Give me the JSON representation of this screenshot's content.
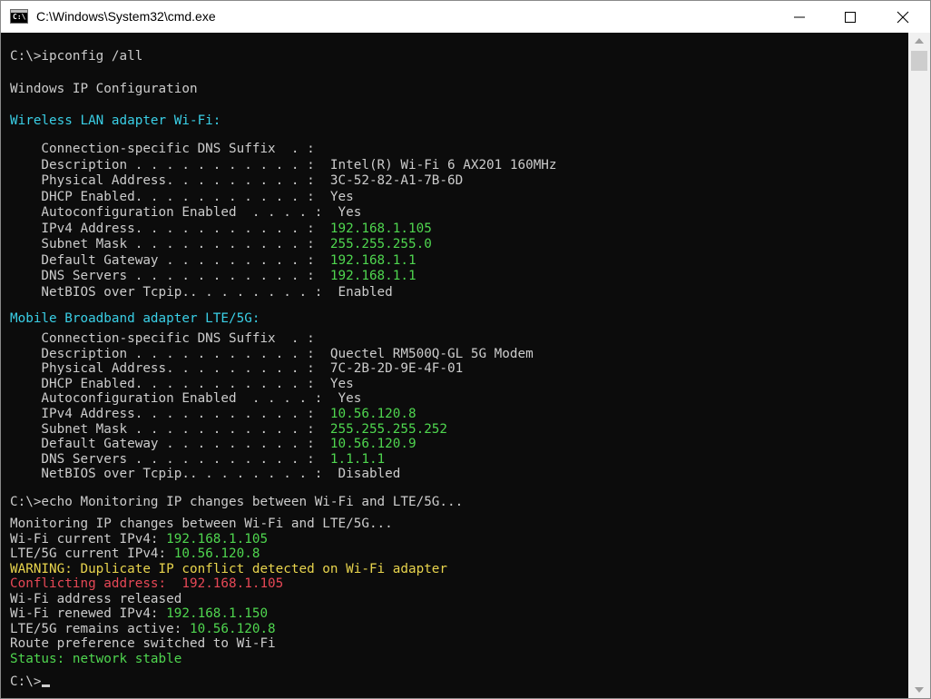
{
  "window": {
    "title": "C:\\Windows\\System32\\cmd.exe",
    "icon_name": "cmd-app-icon",
    "icon_text": "C:\\",
    "controls": {
      "minimize": "minimize-icon",
      "maximize": "maximize-icon",
      "close": "close-icon"
    }
  },
  "colors": {
    "background": "#0c0c0c",
    "text": "#cccccc",
    "header": "#3acfe6",
    "value": "#4fd64f",
    "warning": "#e8d44d",
    "error": "#e74856"
  },
  "console": {
    "command1": "C:\\>ipconfig /all",
    "heading": "Windows IP Configuration",
    "wifi": {
      "header": "Wireless LAN adapter Wi-Fi:",
      "rows": [
        {
          "label": "    Connection-specific DNS Suffix  . :",
          "value": ""
        },
        {
          "label": "    Description . . . . . . . . . . . :  ",
          "value": "Intel(R) Wi-Fi 6 AX201 160MHz"
        },
        {
          "label": "    Physical Address. . . . . . . . . :  ",
          "value": "3C-52-82-A1-7B-6D"
        },
        {
          "label": "    DHCP Enabled. . . . . . . . . . . :  ",
          "value": "Yes"
        },
        {
          "label": "    Autoconfiguration Enabled  . . . . :  ",
          "value": "Yes"
        },
        {
          "label": "    IPv4 Address. . . . . . . . . . . :  ",
          "value": "192.168.1.105"
        },
        {
          "label": "    Subnet Mask . . . . . . . . . . . :  ",
          "value": "255.255.255.0"
        },
        {
          "label": "    Default Gateway . . . . . . . . . :  ",
          "value": "192.168.1.1"
        },
        {
          "label": "    DNS Servers . . . . . . . . . . . :  ",
          "value": "192.168.1.1"
        },
        {
          "label": "    NetBIOS over Tcpip.. . . . . . . . :  ",
          "value": "Enabled"
        }
      ]
    },
    "lte": {
      "header": "Mobile Broadband adapter LTE/5G:",
      "rows": [
        {
          "label": "    Connection-specific DNS Suffix  . :",
          "value": ""
        },
        {
          "label": "    Description . . . . . . . . . . . :  ",
          "value": "Quectel RM500Q-GL 5G Modem"
        },
        {
          "label": "    Physical Address. . . . . . . . . :  ",
          "value": "7C-2B-2D-9E-4F-01"
        },
        {
          "label": "    DHCP Enabled. . . . . . . . . . . :  ",
          "value": "Yes"
        },
        {
          "label": "    Autoconfiguration Enabled  . . . . :  ",
          "value": "Yes"
        },
        {
          "label": "    IPv4 Address. . . . . . . . . . . :  ",
          "value": "10.56.120.8"
        },
        {
          "label": "    Subnet Mask . . . . . . . . . . . :  ",
          "value": "255.255.255.252"
        },
        {
          "label": "    Default Gateway . . . . . . . . . :  ",
          "value": "10.56.120.9"
        },
        {
          "label": "    DNS Servers . . . . . . . . . . . :  ",
          "value": "1.1.1.1"
        },
        {
          "label": "    NetBIOS over Tcpip.. . . . . . . . :  ",
          "value": "Disabled"
        }
      ]
    },
    "command2": "C:\\>echo Monitoring IP changes between Wi-Fi and LTE/5G...",
    "monitor": {
      "echo_line": "Monitoring IP changes between Wi-Fi and LTE/5G...",
      "wifi_label": "Wi-Fi current IPv4: ",
      "wifi_ip": "192.168.1.105",
      "lte_label": "LTE/5G current IPv4: ",
      "lte_ip": "10.56.120.8",
      "warning": "WARNING: Duplicate IP conflict detected on Wi-Fi adapter",
      "conflict_label": "Conflicting address:  ",
      "conflict_ip": "192.168.1.105",
      "released": "Wi-Fi address released",
      "renewed_label": "Wi-Fi renewed IPv4: ",
      "renewed_ip": "192.168.1.150",
      "lte_active_label": "LTE/5G remains active: ",
      "lte_active_ip": "10.56.120.8",
      "route": "Route preference switched to Wi-Fi",
      "status": "Status: network stable"
    },
    "prompt": "C:\\>"
  }
}
